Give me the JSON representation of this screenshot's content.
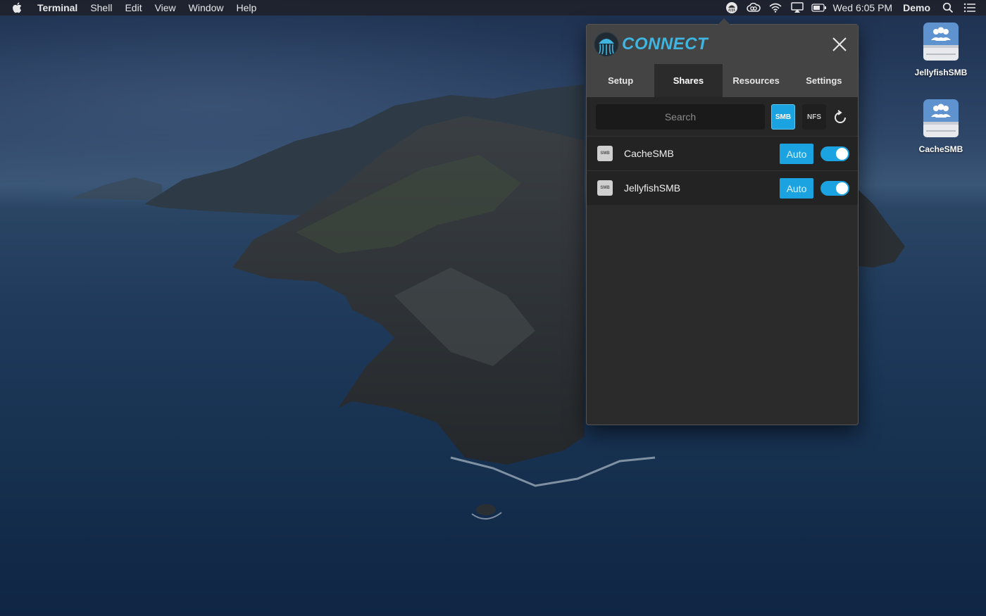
{
  "menubar": {
    "app_name": "Terminal",
    "menus": [
      "Shell",
      "Edit",
      "View",
      "Window",
      "Help"
    ],
    "clock": "Wed 6:05 PM",
    "user": "Demo",
    "status_icons": [
      "jellyfish-connect-icon",
      "creative-cloud-icon",
      "wifi-icon",
      "airplay-icon",
      "battery-icon",
      "spotlight-search-icon",
      "control-center-list-icon"
    ]
  },
  "desktop": {
    "icons": [
      {
        "label": "JellyfishSMB",
        "icon": "network-drive-icon"
      },
      {
        "label": "CacheSMB",
        "icon": "network-drive-icon"
      }
    ]
  },
  "connect": {
    "brand": "CONNECT",
    "tabs": [
      {
        "label": "Setup",
        "active": false
      },
      {
        "label": "Shares",
        "active": true
      },
      {
        "label": "Resources",
        "active": false
      },
      {
        "label": "Settings",
        "active": false
      }
    ],
    "search_placeholder": "Search",
    "filters": {
      "smb": "SMB",
      "nfs": "NFS",
      "active": "SMB"
    },
    "shares": [
      {
        "type": "SMB",
        "name": "CacheSMB",
        "mode": "Auto",
        "enabled": true
      },
      {
        "type": "SMB",
        "name": "JellyfishSMB",
        "mode": "Auto",
        "enabled": true
      }
    ],
    "colors": {
      "accent": "#1aa3e0",
      "brand": "#3fb6e2",
      "panel": "#2b2b2b",
      "header": "#444444"
    }
  }
}
